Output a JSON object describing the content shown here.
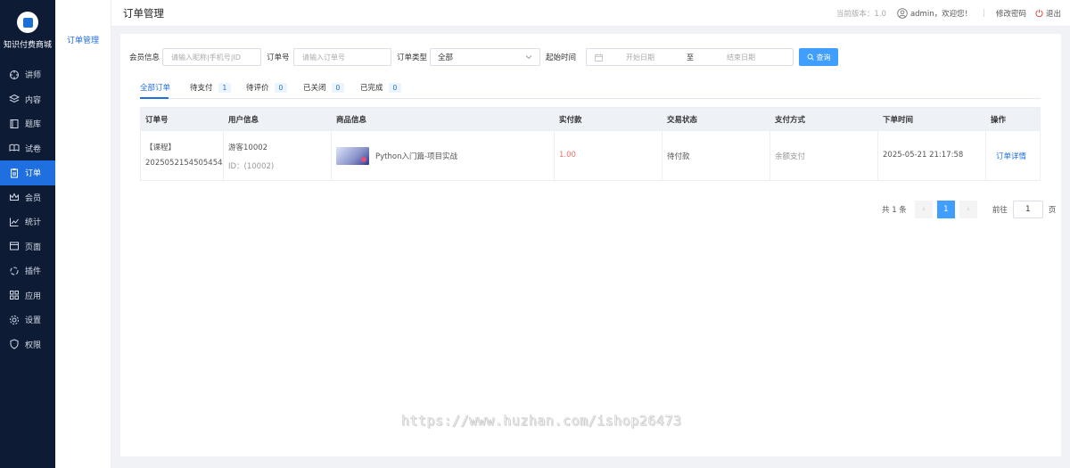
{
  "sidebar": {
    "brand": "知识付费商城",
    "items": [
      {
        "label": "讲师",
        "icon": "teacher-icon"
      },
      {
        "label": "内容",
        "icon": "layers-icon"
      },
      {
        "label": "题库",
        "icon": "book-icon"
      },
      {
        "label": "试卷",
        "icon": "open-book-icon"
      },
      {
        "label": "订单",
        "icon": "clipboard-icon",
        "active": true
      },
      {
        "label": "会员",
        "icon": "crown-icon"
      },
      {
        "label": "统计",
        "icon": "chart-line-icon"
      },
      {
        "label": "页面",
        "icon": "window-icon"
      },
      {
        "label": "插件",
        "icon": "plugin-icon"
      },
      {
        "label": "应用",
        "icon": "apps-grid-icon"
      },
      {
        "label": "设置",
        "icon": "gear-icon"
      },
      {
        "label": "权限",
        "icon": "shield-icon"
      }
    ]
  },
  "submenu": {
    "item": "订单管理"
  },
  "header": {
    "title": "订单管理",
    "version": "当前版本：1.0",
    "welcome": "admin，欢迎您！",
    "separator": "|",
    "change_password": "修改密码",
    "logout": "退出"
  },
  "filters": {
    "member_label": "会员信息",
    "member_placeholder": "请输入昵称|手机号|ID",
    "order_label": "订单号",
    "order_placeholder": "请输入订单号",
    "type_label": "订单类型",
    "type_value": "全部",
    "time_label": "起始时间",
    "start_placeholder": "开始日期",
    "range_sep": "至",
    "end_placeholder": "结束日期",
    "query_button": "查询"
  },
  "tabs": [
    {
      "label": "全部订单",
      "active": true
    },
    {
      "label": "待支付",
      "count": "1"
    },
    {
      "label": "待评价",
      "count": "0"
    },
    {
      "label": "已关闭",
      "count": "0"
    },
    {
      "label": "已完成",
      "count": "0"
    }
  ],
  "table": {
    "headers": [
      "订单号",
      "用户信息",
      "商品信息",
      "实付款",
      "交易状态",
      "支付方式",
      "下单时间",
      "操作"
    ],
    "rows": [
      {
        "order_type": "【课程】",
        "order_no": "2025052154505454",
        "user_name": "游客10002",
        "user_id": "ID：(10002)",
        "product": "Python入门篇-项目实战",
        "paid": "1.00",
        "status": "待付款",
        "payment": "余额支付",
        "time": "2025-05-21 21:17:58",
        "action": "订单详情"
      }
    ]
  },
  "pagination": {
    "total": "共 1 条",
    "prev": "‹",
    "current": "1",
    "next": "›",
    "goto_label": "前往",
    "goto_value": "1",
    "page_suffix": "页"
  },
  "watermark": "https://www.huzhan.com/ishop26473",
  "colors": {
    "accent": "#1f6fe0",
    "sidebar_bg": "#0d1b35",
    "price": "#f56c6c",
    "query_button": "#409eff"
  }
}
